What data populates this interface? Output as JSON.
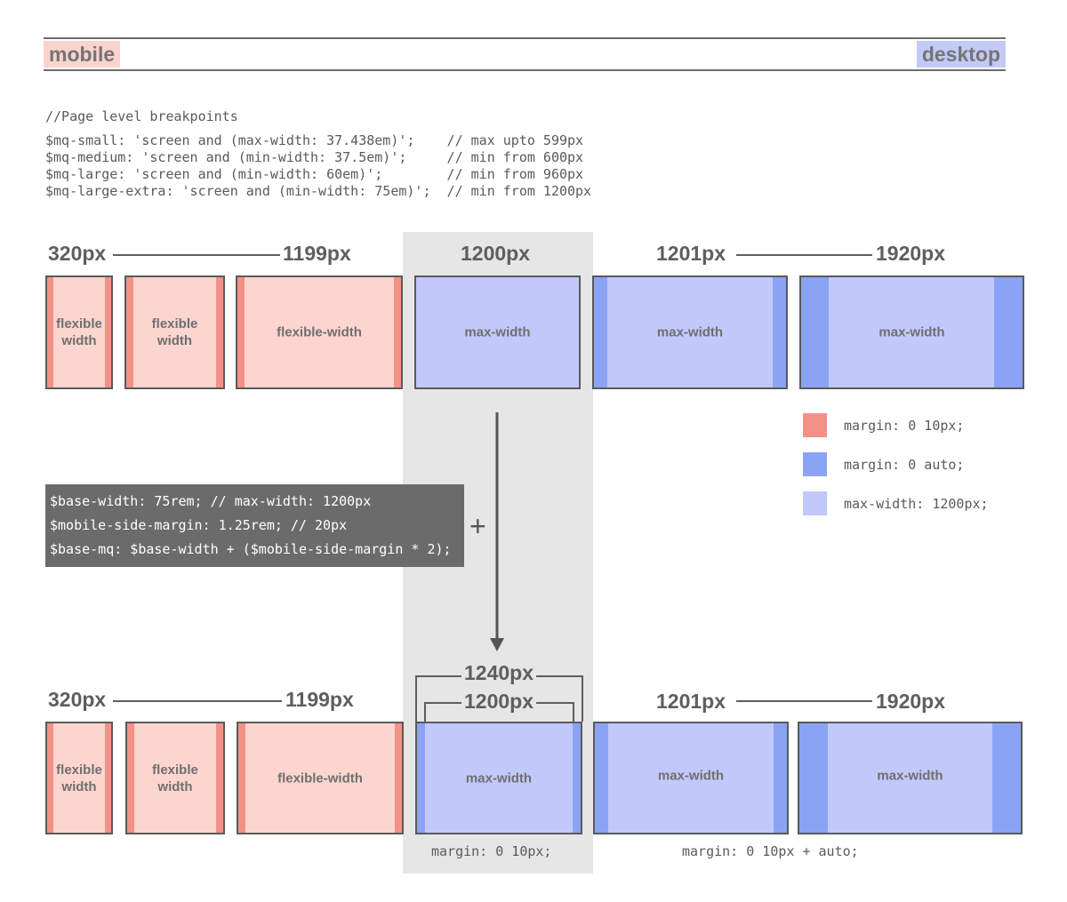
{
  "scale": {
    "mobile": "mobile",
    "desktop": "desktop"
  },
  "code": {
    "comment": "//Page level breakpoints",
    "lines": [
      "$mq-small: 'screen and (max-width: 37.438em)';    // max upto 599px",
      "$mq-medium: 'screen and (min-width: 37.5em)';     // min from 600px",
      "$mq-large: 'screen and (min-width: 60em)';        // min from 960px",
      "$mq-large-extra: 'screen and (min-width: 75em)';  // min from 1200px"
    ]
  },
  "top_row": {
    "px_320": "320px",
    "px_1199": "1199px",
    "px_1200": "1200px",
    "px_1201": "1201px",
    "px_1920": "1920px",
    "labels": {
      "flexible_width": "flexible width",
      "flexible_width_hyphen": "flexible-width",
      "max_width": "max-width"
    }
  },
  "sass": {
    "lines": [
      "$base-width: 75rem; // max-width: 1200px",
      "$mobile-side-margin: 1.25rem; // 20px",
      "$base-mq: $base-width + ($mobile-side-margin * 2);"
    ],
    "plus": "+"
  },
  "legend": [
    {
      "text": "margin: 0 10px;",
      "color": "#f39187"
    },
    {
      "text": "margin: 0 auto;",
      "color": "#8aa3f4"
    },
    {
      "text": "max-width: 1200px;",
      "color": "#c0c9fa"
    }
  ],
  "bottom_row": {
    "px_320": "320px",
    "px_1199": "1199px",
    "px_1240": "1240px",
    "px_1200": "1200px",
    "px_1201": "1201px",
    "px_1920": "1920px",
    "caption_left": "margin: 0 10px;",
    "caption_right": "margin: 0 10px + auto;"
  },
  "colors": {
    "pink_fill": "#fdd5cf",
    "pink_edge": "#f39187",
    "blue_fill": "#c0c9fa",
    "blue_edge": "#8aa3f4",
    "gray_column": "#e6e6e6",
    "dark_box": "#6b6b6b"
  }
}
